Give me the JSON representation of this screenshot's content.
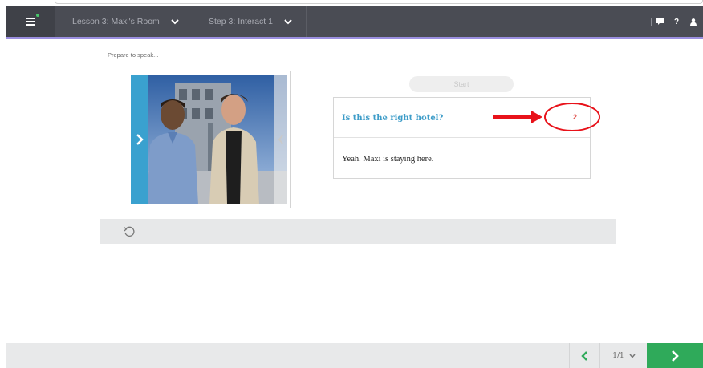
{
  "topbar": {
    "lesson_label": "Lesson 3: Maxi's Room",
    "step_label": "Step 3: Interact 1",
    "icons": [
      "menu-icon",
      "chevron-down-icon",
      "chat-icon",
      "help-icon",
      "user-icon"
    ],
    "help_label": "?"
  },
  "activity": {
    "prompt": "Prepare to speak...",
    "start_label": "Start",
    "question": "Is this the right hotel?",
    "question_number": "2",
    "answer": "Yeah. Maxi is staying here."
  },
  "annotation": {
    "color": "#e8121a"
  },
  "footer": {
    "page_indicator": "1/1"
  },
  "colors": {
    "topbar": "#4a4c54",
    "accent_line": "#9b8fe0",
    "question_text": "#3d9cc8",
    "next_button": "#2faa5a",
    "photo_tab": "#3aa1cf"
  }
}
